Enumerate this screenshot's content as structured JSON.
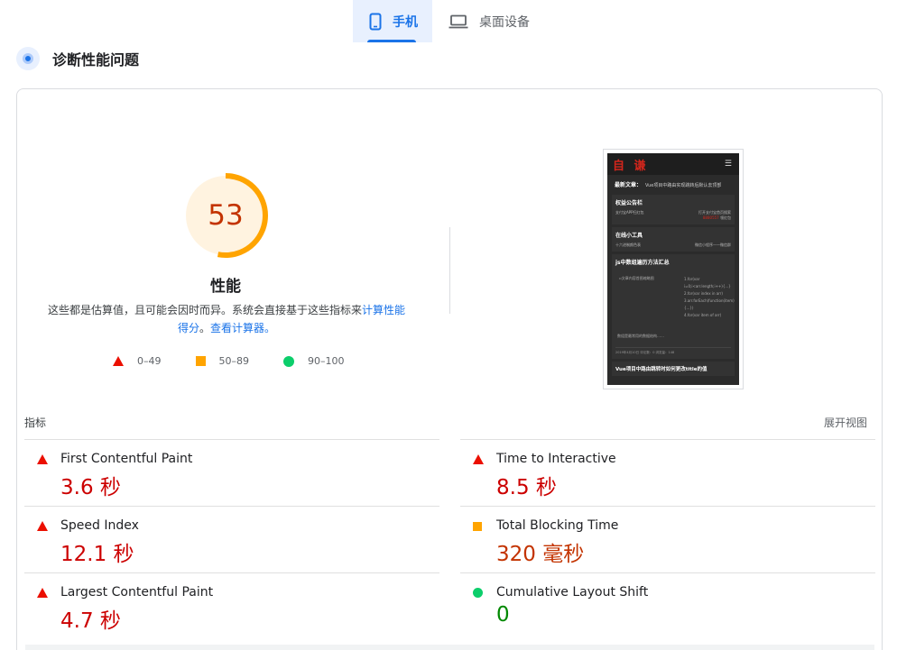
{
  "tabs": [
    {
      "label": "手机",
      "icon": "phone-icon",
      "active": true
    },
    {
      "label": "桌面设备",
      "icon": "laptop-icon",
      "active": false
    }
  ],
  "section": {
    "title": "诊断性能问题",
    "icon": "lighthouse-icon"
  },
  "score": {
    "value": 53,
    "fraction": 0.53,
    "color": "#ffa400",
    "text_color": "#c33300"
  },
  "performance_label": "性能",
  "description": {
    "text": "这些都是估算值，且可能会因时而异。系统会直接基于这些指标来",
    "link1": "计算性能得分",
    "sep": "。",
    "link2": "查看计算器。"
  },
  "legend": [
    {
      "range": "0–49",
      "shape": "triangle",
      "color": "#eb0f00"
    },
    {
      "range": "50–89",
      "shape": "square",
      "color": "#ffa400"
    },
    {
      "range": "90–100",
      "shape": "circle",
      "color": "#0cce6b"
    }
  ],
  "thumbnail": {
    "logo": "自 谦",
    "news_label": "最新文章：",
    "news_text": "Vue项目中路由实现跳转后默认去顶部",
    "box1_title": "权益公告栏",
    "box1_left": "支付宝APP扫红包",
    "box1_right": "打开支付宝首页搜索",
    "box1_code": "8880557",
    "box1_right2": "领红包",
    "box2_title": "在线小工具",
    "box2_left": "十六进制颜色表",
    "box2_right": "微信小程序——微信群",
    "article_title": "js中数组遍历方法汇总",
    "article_img": "文章内容首图缩略图",
    "article_code": [
      "1.for(var i=0;i<arr.length;i++){...}",
      "2.for(var index in arr)",
      "3.arr.forEach(function(item){...})",
      "4.for(var item of arr)"
    ],
    "article_foot": "数组是最常用的数据结构……",
    "article_meta": "2019年4月10日   评论数：0   浏览量：148",
    "last_title": "Vue项目中路由跳转时如何更改title的值"
  },
  "metrics_header": {
    "label": "指标",
    "expand": "展开视图"
  },
  "metrics": [
    {
      "name": "First Contentful Paint",
      "value": "3.6 秒",
      "status": "fail"
    },
    {
      "name": "Time to Interactive",
      "value": "8.5 秒",
      "status": "fail"
    },
    {
      "name": "Speed Index",
      "value": "12.1 秒",
      "status": "fail"
    },
    {
      "name": "Total Blocking Time",
      "value": "320 毫秒",
      "status": "average"
    },
    {
      "name": "Largest Contentful Paint",
      "value": "4.7 秒",
      "status": "fail"
    },
    {
      "name": "Cumulative Layout Shift",
      "value": "0",
      "status": "pass"
    }
  ]
}
